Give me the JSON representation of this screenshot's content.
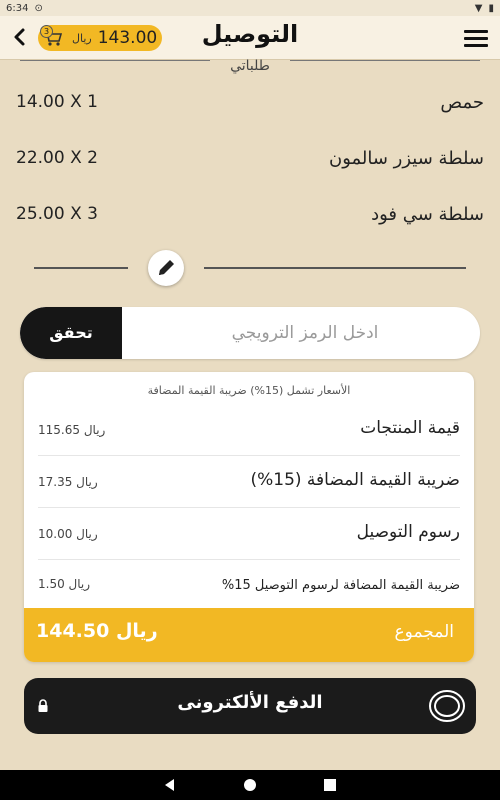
{
  "status_bar": {
    "time": "6:34"
  },
  "header": {
    "title": "التوصيل",
    "cart": {
      "badge": "3",
      "currency": "ريال",
      "amount": "143.00"
    }
  },
  "section_label": "طلباتي",
  "items": [
    {
      "name": "حمص",
      "qty": "14.00 X 1"
    },
    {
      "name": "سلطة سيزر سالمون",
      "qty": "22.00 X 2"
    },
    {
      "name": "سلطة سي  فود",
      "qty": "25.00 X 3"
    }
  ],
  "promo": {
    "placeholder": "ادخل الرمز الترويجي",
    "verify_label": "تحقق"
  },
  "summary": {
    "note": "الأسعار تشمل (15%) ضريبة القيمة المضافة",
    "rows": [
      {
        "label": "قيمة المنتجات",
        "value": "115.65 ريال"
      },
      {
        "label": "ضريبة القيمة المضافة (15%)",
        "value": "17.35 ريال"
      },
      {
        "label": "رسوم التوصيل",
        "value": "10.00 ريال"
      },
      {
        "label": "ضريبة القيمة المضافة لرسوم التوصيل 15%",
        "value": "1.50 ريال"
      }
    ],
    "total": {
      "label": "المجموع",
      "value": "144.50 ريال"
    }
  },
  "pay_button": {
    "label": "الدفع الألكترونى"
  },
  "colors": {
    "accent": "#f2b824",
    "dark": "#1b1b1b",
    "background": "#e9dcc2"
  }
}
